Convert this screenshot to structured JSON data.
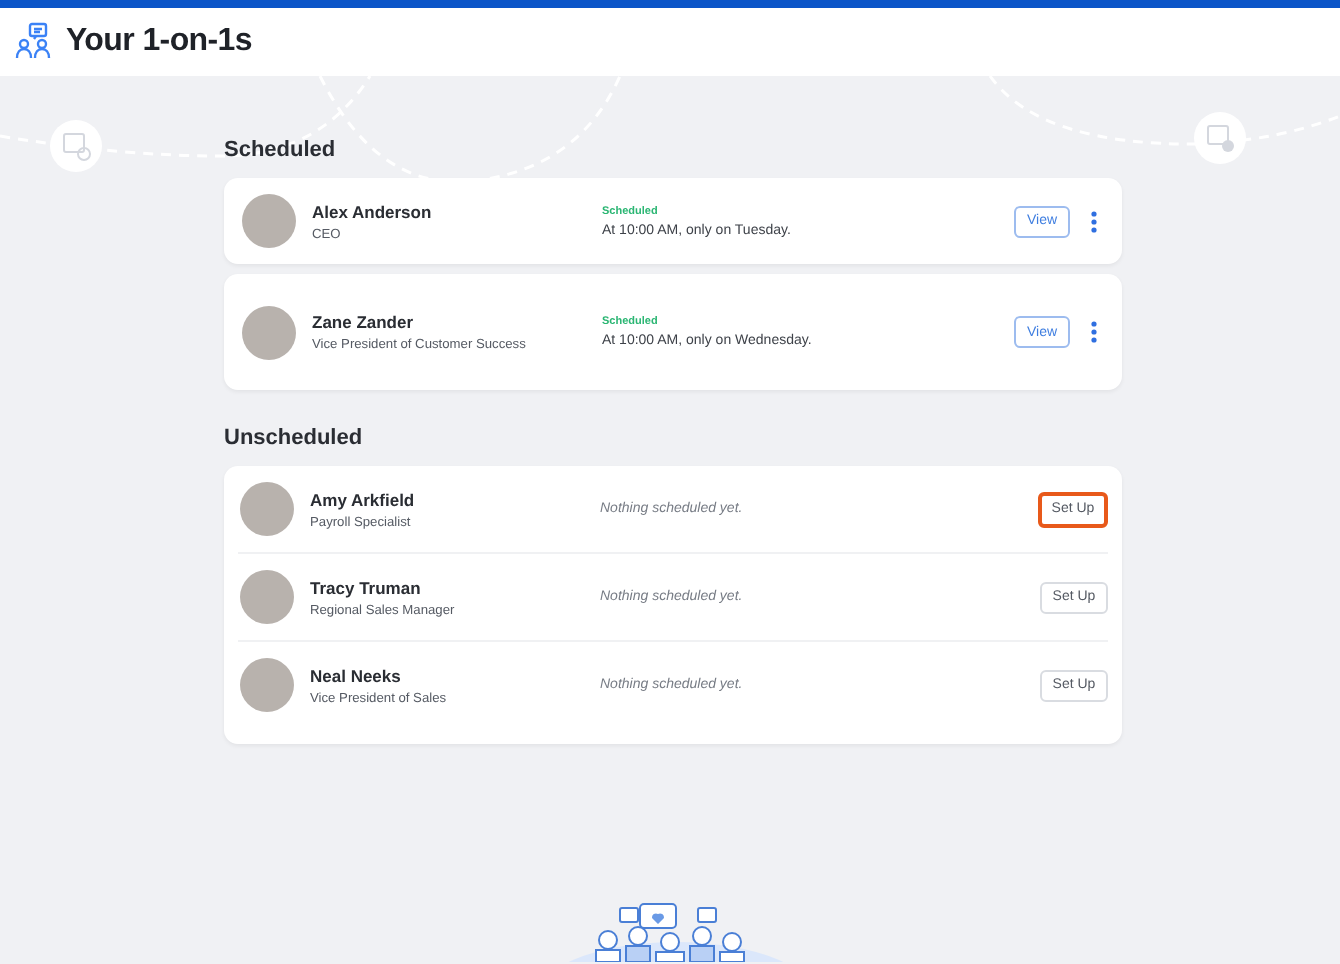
{
  "header": {
    "title": "Your 1-on-1s"
  },
  "scheduled": {
    "heading": "Scheduled",
    "items": [
      {
        "name": "Alex Anderson",
        "role": "CEO",
        "status": "Scheduled",
        "detail": "At 10:00 AM, only on Tuesday.",
        "action": "View"
      },
      {
        "name": "Zane Zander",
        "role": "Vice President of Customer Success",
        "status": "Scheduled",
        "detail": "At 10:00 AM, only on Wednesday.",
        "action": "View"
      }
    ]
  },
  "unscheduled": {
    "heading": "Unscheduled",
    "items": [
      {
        "name": "Amy Arkfield",
        "role": "Payroll Specialist",
        "note": "Nothing scheduled yet.",
        "action": "Set Up",
        "focused": true
      },
      {
        "name": "Tracy Truman",
        "role": "Regional Sales Manager",
        "note": "Nothing scheduled yet.",
        "action": "Set Up",
        "focused": false
      },
      {
        "name": "Neal Neeks",
        "role": "Vice President of Sales",
        "note": "Nothing scheduled yet.",
        "action": "Set Up",
        "focused": false
      }
    ]
  }
}
